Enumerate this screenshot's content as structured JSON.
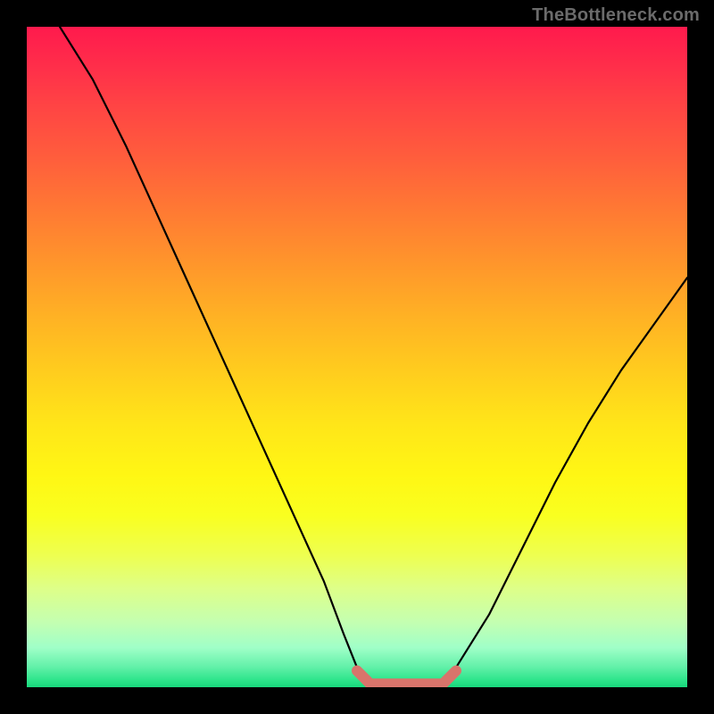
{
  "watermark": "TheBottleneck.com",
  "chart_data": {
    "type": "line",
    "title": "",
    "xlabel": "",
    "ylabel": "",
    "xlim": [
      0,
      100
    ],
    "ylim": [
      0,
      100
    ],
    "grid": false,
    "legend": false,
    "series": [
      {
        "name": "black-curve",
        "color": "#000000",
        "x": [
          5,
          10,
          15,
          20,
          25,
          30,
          35,
          40,
          45,
          48,
          50,
          52,
          55,
          58,
          60,
          63,
          65,
          70,
          75,
          80,
          85,
          90,
          95,
          100
        ],
        "values": [
          100,
          92,
          82,
          71,
          60,
          49,
          38,
          27,
          16,
          8,
          3,
          0,
          0,
          0,
          0,
          0,
          3,
          11,
          21,
          31,
          40,
          48,
          55,
          62
        ]
      },
      {
        "name": "bottom-highlight",
        "color": "#d9746b",
        "x": [
          50,
          52,
          55,
          58,
          60,
          63,
          65
        ],
        "values": [
          2.5,
          0.5,
          0.5,
          0.5,
          0.5,
          0.5,
          2.5
        ]
      }
    ],
    "background_gradient_stops": [
      {
        "pct": 0,
        "color": "#ff1a4d"
      },
      {
        "pct": 20,
        "color": "#ff5e3c"
      },
      {
        "pct": 40,
        "color": "#ffaa26"
      },
      {
        "pct": 60,
        "color": "#ffe519"
      },
      {
        "pct": 80,
        "color": "#eeff50"
      },
      {
        "pct": 95,
        "color": "#8af5b8"
      },
      {
        "pct": 100,
        "color": "#18d87c"
      }
    ]
  }
}
